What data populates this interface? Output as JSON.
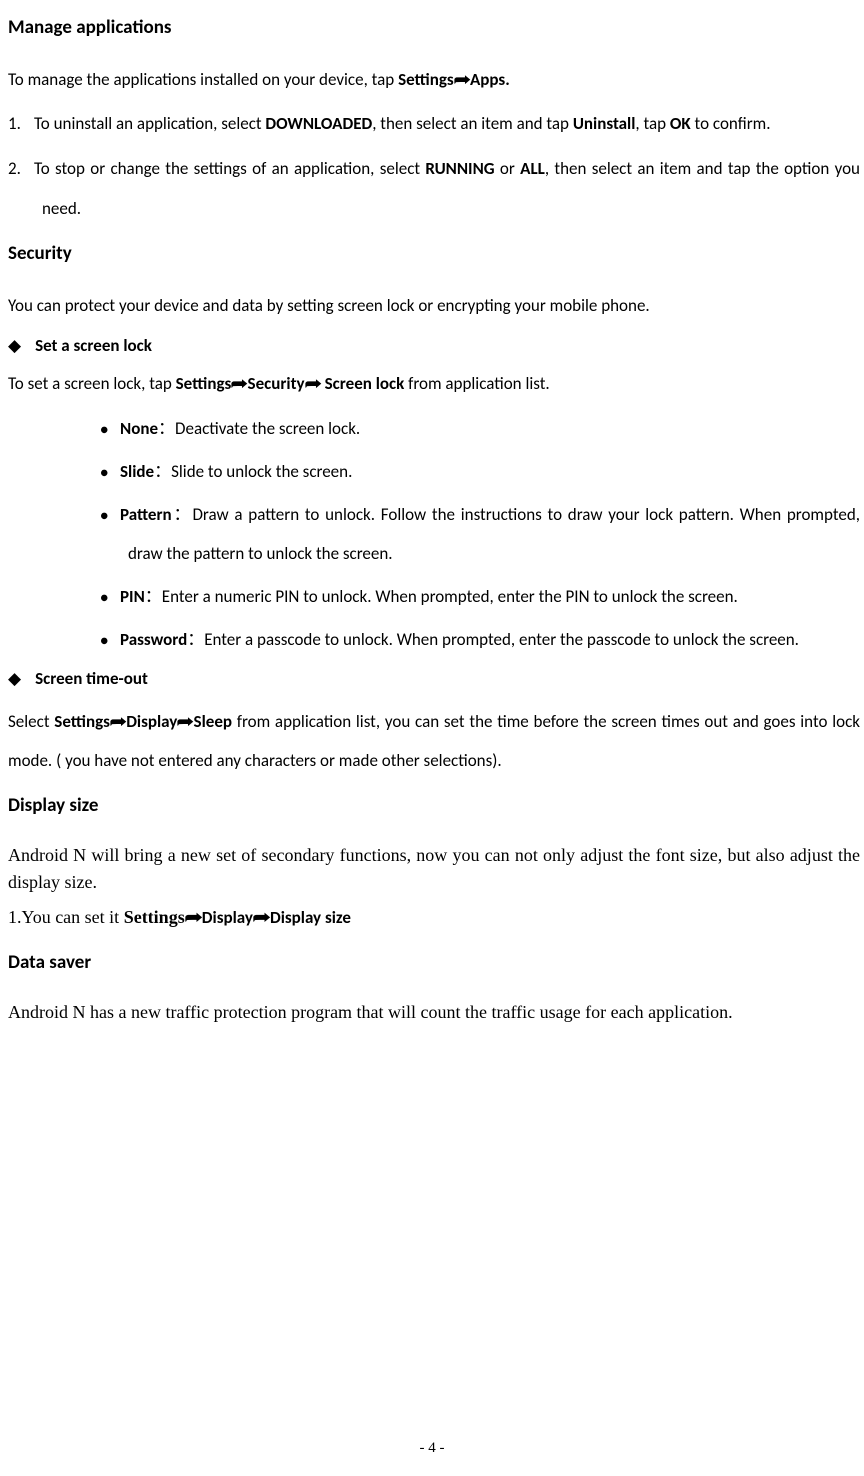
{
  "sections": {
    "manage_apps": {
      "title": "Manage applications",
      "intro_pre": "To manage the applications installed on your device, tap ",
      "intro_b1": "Settings",
      "intro_b2": "Apps.",
      "item1_pre": "To uninstall an application, select ",
      "item1_b1": "DOWNLOADED",
      "item1_mid1": ", then select an item and tap ",
      "item1_b2": "Uninstall",
      "item1_mid2": ", tap ",
      "item1_b3": "OK",
      "item1_post": " to confirm.",
      "item2_pre": "To stop or change the settings of an application, select ",
      "item2_b1": "RUNNING",
      "item2_mid": " or ",
      "item2_b2": "ALL",
      "item2_post": ", then select an item and tap the option you need."
    },
    "security": {
      "title": "Security",
      "intro": "You can protect your device and data by setting screen lock or encrypting your mobile phone.",
      "d1": "Set a screen lock",
      "d1_intro_pre": "To set a screen lock, tap ",
      "d1_b1": "Settings",
      "d1_b2": "Security",
      "d1_b3": " Screen lock",
      "d1_intro_post": " from application list.",
      "opts": {
        "none_b": "None",
        "none_colon": "：",
        "none_txt": "Deactivate the screen lock.",
        "slide_b": "Slide",
        "slide_colon": "：",
        "slide_txt": "Slide to unlock the screen.",
        "pattern_b": "Pattern",
        "pattern_colon": "：",
        "pattern_txt": "Draw a pattern to unlock. Follow the instructions to draw your lock pattern. When prompted, draw the pattern to unlock the screen.",
        "pin_b": "PIN",
        "pin_colon": "：",
        "pin_txt": "Enter a numeric PIN to unlock. When prompted, enter the PIN to unlock the screen.",
        "pwd_b": "Password",
        "pwd_colon": "：",
        "pwd_txt": "Enter a passcode to unlock. When prompted, enter the passcode to unlock the screen."
      },
      "d2": "Screen time-out",
      "d2_pre": "Select ",
      "d2_b1": "Settings",
      "d2_b2": "Display",
      "d2_b3": "Sleep",
      "d2_post": " from application list, you can set the time before the screen times out and goes into lock mode. ( you have not entered any characters or made other selections)."
    },
    "display_size": {
      "title": "Display size",
      "p1": "Android N will bring a new set of secondary functions, now you can not only adjust the font size, but also adjust the display size.",
      "p2_pre": "1.You can set it ",
      "p2_b1": "Settings",
      "p2_b2": "Display",
      "p2_b3": "Display size"
    },
    "data_saver": {
      "title": "Data saver",
      "p1": "Android N has a new traffic protection program that will count the traffic usage for each application."
    }
  },
  "page_number": "- 4 -"
}
